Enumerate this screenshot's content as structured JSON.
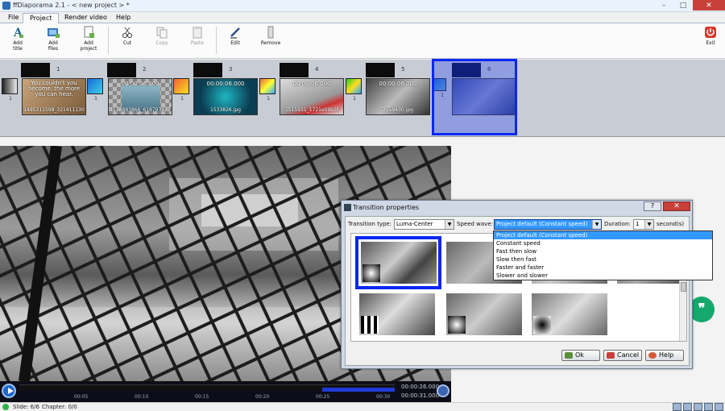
{
  "window": {
    "title": "ffDiaporama 2.1 - < new project > *"
  },
  "menu": {
    "tabs": [
      "File",
      "Project",
      "Render video",
      "Help"
    ],
    "active": "Project"
  },
  "ribbon": {
    "add_title": "Add\ntitle",
    "add_files": "Add\nfiles",
    "add_project": "Add\nproject",
    "cut": "Cut",
    "copy": "Copy",
    "paste": "Paste",
    "edit": "Edit",
    "remove": "Remove",
    "exit": "Exit"
  },
  "timeline": {
    "slides": [
      {
        "num": "1",
        "time": "",
        "caption": "You couldn't you become, the more you can hear.",
        "file": "1495311598_321411130",
        "trans_num": "1"
      },
      {
        "num": "2",
        "time": "00:00:06.000",
        "caption": "",
        "file": "1578883866_618797877",
        "trans_num": "1"
      },
      {
        "num": "3",
        "time": "00:00:06.000",
        "caption": "",
        "file": "1533826.jpg",
        "trans_num": "1"
      },
      {
        "num": "4",
        "time": "00:00:06.000",
        "caption": "",
        "file": "1515931_1721e09b5f",
        "trans_num": "1"
      },
      {
        "num": "5",
        "time": "00:00:06.000",
        "caption": "",
        "file": "2559430.jpg",
        "trans_num": "1"
      },
      {
        "num": "6",
        "time": "",
        "caption": "",
        "file": "",
        "trans_num": "1"
      }
    ],
    "first_trans_num": "1"
  },
  "playback": {
    "ticks": [
      "00:05",
      "00:10",
      "00:15",
      "00:20",
      "00:25",
      "00:30"
    ],
    "current_time": "00:00:26.000",
    "total_time": "00:00:31.000"
  },
  "status": {
    "slide": "Slide: 6/6",
    "chapter": "Chapter: 0/0"
  },
  "dialog": {
    "title": "Transition properties",
    "transition_type_label": "Transition type:",
    "transition_type_value": "Luma-Center",
    "speed_wave_label": "Speed wave:",
    "speed_wave_value": "Project default (Constant speed)",
    "duration_label": "Duration:",
    "duration_value": "1",
    "duration_unit": "second(s)",
    "speed_options": [
      "Project default (Constant speed)",
      "Constant speed",
      "Fast then slow",
      "Slow then fast",
      "Faster and faster",
      "Slower and slower"
    ],
    "ok": "Ok",
    "cancel": "Cancel",
    "help": "Help",
    "help_button_glyph": "?",
    "close_glyph": "✕"
  },
  "colors": {
    "selection": "#0a27f2",
    "accent": "#3399ff",
    "chat_bubble": "#15a86c"
  },
  "icons": {
    "chat": "chat-bubble-icon"
  }
}
